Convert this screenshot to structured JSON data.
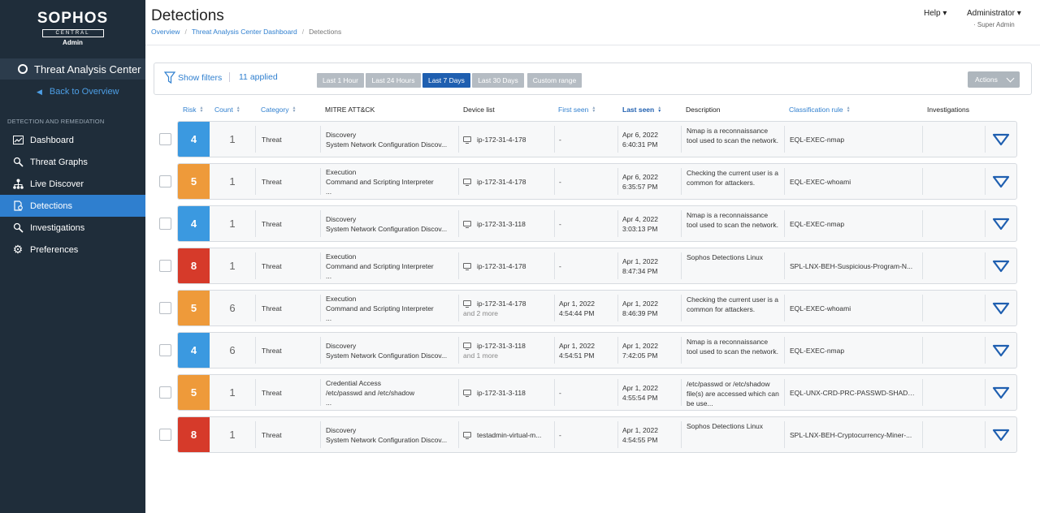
{
  "sidebar": {
    "logo_word": "SOPHOS",
    "logo_central": "CENTRAL",
    "logo_admin": "Admin",
    "app_title": "Threat Analysis Center",
    "back_label": "Back to Overview",
    "section_label": "DETECTION AND REMEDIATION",
    "items": [
      {
        "label": "Dashboard",
        "icon": "chart-icon"
      },
      {
        "label": "Threat Graphs",
        "icon": "threat-graph-icon"
      },
      {
        "label": "Live Discover",
        "icon": "network-icon"
      },
      {
        "label": "Detections",
        "icon": "detection-icon"
      },
      {
        "label": "Investigations",
        "icon": "investigation-icon"
      },
      {
        "label": "Preferences",
        "icon": "gear-icon"
      }
    ]
  },
  "header": {
    "title": "Detections",
    "breadcrumb": [
      "Overview",
      "Threat Analysis Center Dashboard",
      "Detections"
    ],
    "help": "Help",
    "admin": "Administrator",
    "admin_role": "Super Admin"
  },
  "filters": {
    "show_filters": "Show filters",
    "applied": "11 applied",
    "ranges": [
      "Last 1 Hour",
      "Last 24 Hours",
      "Last 7 Days",
      "Last 30 Days",
      "Custom range"
    ],
    "active_range": "Last 7 Days",
    "actions": "Actions"
  },
  "columns": {
    "risk": "Risk",
    "count": "Count",
    "category": "Category",
    "mitre": "MITRE ATT&CK",
    "device": "Device list",
    "first_seen": "First seen",
    "last_seen": "Last seen",
    "description": "Description",
    "rule": "Classification rule",
    "investigations": "Investigations"
  },
  "colors": {
    "risk_4": "#3b99e0",
    "risk_5": "#ee9a3a",
    "risk_8": "#d63a2a",
    "accent": "#2f7fcf"
  },
  "rows": [
    {
      "risk": "4",
      "count": "1",
      "category": "Threat",
      "mitre": [
        "Discovery",
        "System Network Configuration Discov..."
      ],
      "device": "ip-172-31-4-178",
      "device_more": "",
      "first_seen": [
        "-"
      ],
      "last_seen": [
        "Apr 6, 2022",
        "6:40:31 PM"
      ],
      "description": "Nmap is a reconnaissance tool used to scan the network.",
      "rule": "EQL-EXEC-nmap"
    },
    {
      "risk": "5",
      "count": "1",
      "category": "Threat",
      "mitre": [
        "Execution",
        "Command and Scripting Interpreter",
        "..."
      ],
      "device": "ip-172-31-4-178",
      "device_more": "",
      "first_seen": [
        "-"
      ],
      "last_seen": [
        "Apr 6, 2022",
        "6:35:57 PM"
      ],
      "description": "Checking the current user is a common for attackers.",
      "rule": "EQL-EXEC-whoami"
    },
    {
      "risk": "4",
      "count": "1",
      "category": "Threat",
      "mitre": [
        "Discovery",
        "System Network Configuration Discov..."
      ],
      "device": "ip-172-31-3-118",
      "device_more": "",
      "first_seen": [
        "-"
      ],
      "last_seen": [
        "Apr 4, 2022",
        "3:03:13 PM"
      ],
      "description": "Nmap is a reconnaissance tool used to scan the network.",
      "rule": "EQL-EXEC-nmap"
    },
    {
      "risk": "8",
      "count": "1",
      "category": "Threat",
      "mitre": [
        "Execution",
        "Command and Scripting Interpreter",
        "..."
      ],
      "device": "ip-172-31-4-178",
      "device_more": "",
      "first_seen": [
        "-"
      ],
      "last_seen": [
        "Apr 1, 2022",
        "8:47:34 PM"
      ],
      "description": "Sophos Detections Linux",
      "rule": "SPL-LNX-BEH-Suspicious-Program-N..."
    },
    {
      "risk": "5",
      "count": "6",
      "category": "Threat",
      "mitre": [
        "Execution",
        "Command and Scripting Interpreter",
        "..."
      ],
      "device": "ip-172-31-4-178",
      "device_more": "and 2 more",
      "first_seen": [
        "Apr 1, 2022",
        "4:54:44 PM"
      ],
      "last_seen": [
        "Apr 1, 2022",
        "8:46:39 PM"
      ],
      "description": "Checking the current user is a common for attackers.",
      "rule": "EQL-EXEC-whoami"
    },
    {
      "risk": "4",
      "count": "6",
      "category": "Threat",
      "mitre": [
        "Discovery",
        "System Network Configuration Discov..."
      ],
      "device": "ip-172-31-3-118",
      "device_more": "and 1 more",
      "first_seen": [
        "Apr 1, 2022",
        "4:54:51 PM"
      ],
      "last_seen": [
        "Apr 1, 2022",
        "7:42:05 PM"
      ],
      "description": "Nmap is a reconnaissance tool used to scan the network.",
      "rule": "EQL-EXEC-nmap"
    },
    {
      "risk": "5",
      "count": "1",
      "category": "Threat",
      "mitre": [
        "Credential Access",
        "/etc/passwd and /etc/shadow",
        "..."
      ],
      "device": "ip-172-31-3-118",
      "device_more": "",
      "first_seen": [
        "-"
      ],
      "last_seen": [
        "Apr 1, 2022",
        "4:55:54 PM"
      ],
      "description": "/etc/passwd or /etc/shadow file(s) are accessed which can be use...",
      "rule": "EQL-UNX-CRD-PRC-PASSWD-SHADO..."
    },
    {
      "risk": "8",
      "count": "1",
      "category": "Threat",
      "mitre": [
        "Discovery",
        "System Network Configuration Discov..."
      ],
      "device": "testadmin-virtual-m...",
      "device_more": "",
      "first_seen": [
        "-"
      ],
      "last_seen": [
        "Apr 1, 2022",
        "4:54:55 PM"
      ],
      "description": "Sophos Detections Linux",
      "rule": "SPL-LNX-BEH-Cryptocurrency-Miner-..."
    }
  ]
}
